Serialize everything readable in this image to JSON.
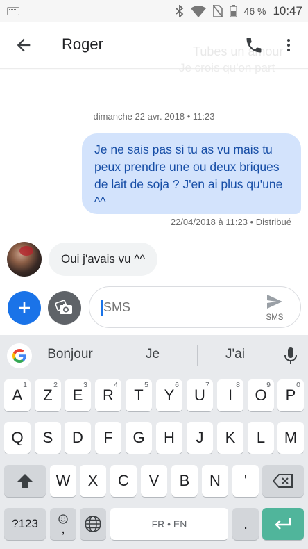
{
  "status_bar": {
    "battery": "46 %",
    "time": "10:47"
  },
  "background_ghost_text": {
    "line1": "Tubes un amour",
    "line2": "Je crois qu'on part"
  },
  "header": {
    "contact_name": "Roger"
  },
  "conversation": {
    "date": "dimanche 22 avr. 2018 • 11:23",
    "outgoing_message": "Je ne sais pas si tu as vu mais tu peux prendre une ou deux briques de lait de soja ? J'en ai plus qu'une ^^",
    "outgoing_meta": "22/04/2018 à 11:23 • Distribué",
    "incoming_message": "Oui j'avais vu ^^"
  },
  "compose": {
    "placeholder": "SMS",
    "send_label": "SMS"
  },
  "keyboard": {
    "suggestions": [
      "Bonjour",
      "Je",
      "J'ai"
    ],
    "row1": [
      {
        "label": "A",
        "hint": "1"
      },
      {
        "label": "Z",
        "hint": "2"
      },
      {
        "label": "E",
        "hint": "3"
      },
      {
        "label": "R",
        "hint": "4"
      },
      {
        "label": "T",
        "hint": "5"
      },
      {
        "label": "Y",
        "hint": "6"
      },
      {
        "label": "U",
        "hint": "7"
      },
      {
        "label": "I",
        "hint": "8"
      },
      {
        "label": "O",
        "hint": "9"
      },
      {
        "label": "P",
        "hint": "0"
      }
    ],
    "row2": [
      "Q",
      "S",
      "D",
      "F",
      "G",
      "H",
      "J",
      "K",
      "L",
      "M"
    ],
    "row3": [
      "W",
      "X",
      "C",
      "V",
      "B",
      "N",
      "'"
    ],
    "symbols_label": "?123",
    "comma_label": ",",
    "space_label": "FR • EN",
    "period_label": "."
  },
  "colors": {
    "accent": "#1a73e8",
    "outgoing_bubble": "#d3e3fc",
    "enter_key": "#50b59b"
  },
  "icons": [
    "keyboard-icon",
    "bluetooth-icon",
    "wifi-icon",
    "no-sim-icon",
    "battery-icon",
    "back-arrow-icon",
    "phone-icon",
    "more-vert-icon",
    "plus-icon",
    "camera-icon",
    "send-icon",
    "google-icon",
    "mic-icon",
    "shift-icon",
    "backspace-icon",
    "emoji-icon",
    "globe-icon",
    "enter-icon"
  ]
}
